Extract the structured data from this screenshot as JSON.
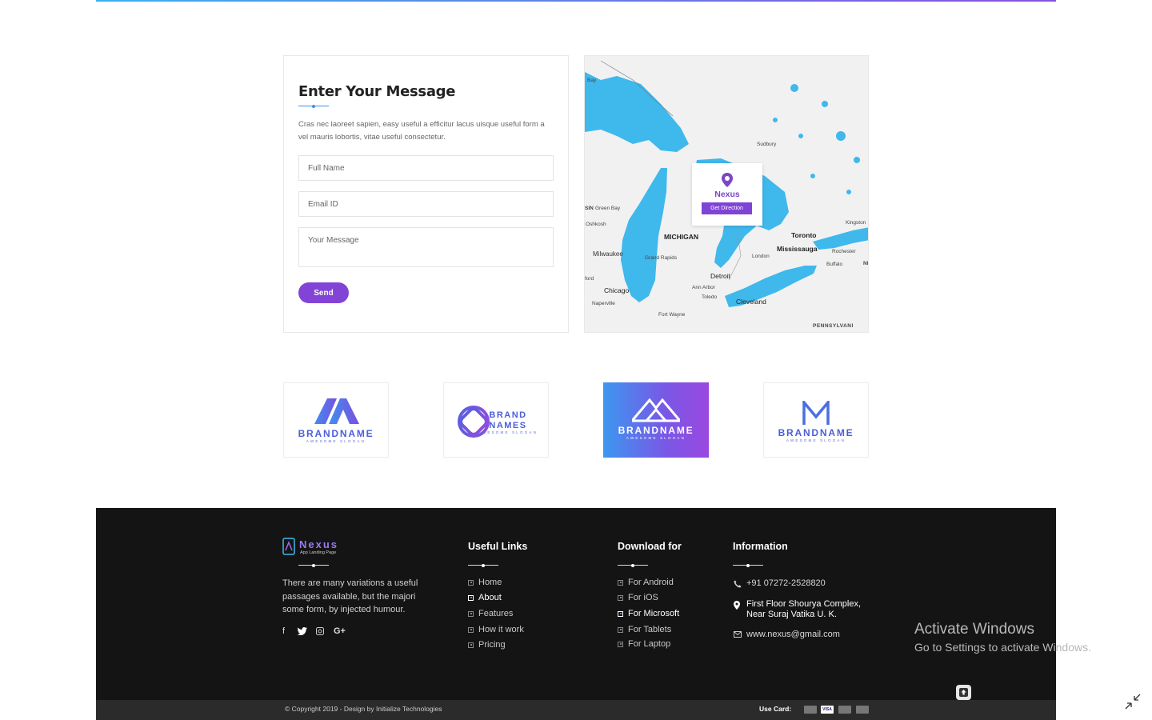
{
  "contact": {
    "title": "Enter Your Message",
    "description": "Cras nec laoreet sapien, easy useful a efficitur lacus uisque useful form a vel mauris lobortis, vitae useful  consectetur.",
    "full_name_placeholder": "Full Name",
    "email_placeholder": "Email ID",
    "message_placeholder": "Your Message",
    "send_label": "Send"
  },
  "map": {
    "popup_name": "Nexus",
    "direction_label": "Get Direction",
    "places": {
      "bay": "Bay",
      "sudbury": "Sudbury",
      "green_bay": "Green Bay",
      "sin": "SIN",
      "oshkosh": "Oshkosh",
      "michigan": "MICHIGAN",
      "milwaukee": "Milwaukee",
      "grand_rapids": "Grand Rapids",
      "toronto": "Toronto",
      "mississauga": "Mississauga",
      "kingston": "Kingston",
      "rochester": "Rochester",
      "buffalo": "Buffalo",
      "london": "London",
      "ford": "ford",
      "chicago": "Chicago",
      "naperville": "Naperville",
      "detroit": "Detroit",
      "ann_arbor": "Ann Arbor",
      "toledo": "Toledo",
      "cleveland": "Cleveland",
      "fort_wayne": "Fort Wayne",
      "pennsylvania": "PENNSYLVANI",
      "ni": "NI"
    }
  },
  "brands": [
    {
      "name": "BRANDNAME",
      "slogan": "AWESOME SLOGAN"
    },
    {
      "name": "BRAND",
      "name2": "NAMES",
      "slogan": "AWESOME SLOGAN"
    },
    {
      "name": "BRANDNAME",
      "slogan": "AWESOME SLOGAN"
    },
    {
      "name": "BRANDNAME",
      "slogan": "AWESOME SLOGAN"
    }
  ],
  "footer": {
    "logo_name": "Nexus",
    "logo_tagline": "App Landing Page",
    "about": "There are many variations a useful passages available, but the majori some form, by injected humour.",
    "social": [
      "f",
      "G+"
    ],
    "useful_links": {
      "title": "Useful Links",
      "items": [
        "Home",
        "About",
        "Features",
        "How it work",
        "Pricing"
      ]
    },
    "download": {
      "title": "Download for",
      "items": [
        "For Android",
        "For iOS",
        "For Microsoft",
        "For Tablets",
        "For Laptop"
      ]
    },
    "information": {
      "title": "Information",
      "phone": "+91 07272-2528820",
      "address_line1": "First Floor Shourya Complex,",
      "address_line2": "Near Suraj Vatika U. K.",
      "website": "www.nexus@gmail.com"
    },
    "copyright": "© Copyright 2019 - Design by Initialize Technologies",
    "use_card": "Use Card:",
    "cards": [
      "",
      "VISA",
      "",
      ""
    ]
  },
  "windows_watermark": {
    "title": "Activate Windows",
    "subtitle": "Go to Settings to activate Windows."
  }
}
